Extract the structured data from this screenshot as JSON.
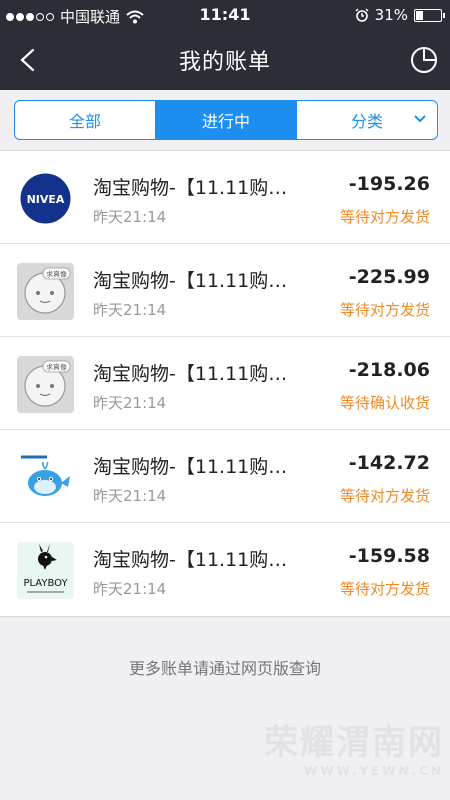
{
  "status_bar": {
    "carrier": "中国联通",
    "time": "11:41",
    "battery_pct": "31%",
    "battery_level": 0.31,
    "signal_strength": 3
  },
  "header": {
    "title": "我的账单",
    "back_icon": "chevron-left-icon",
    "chart_icon": "pie-chart-icon"
  },
  "tabs": [
    {
      "label": "全部",
      "active": false
    },
    {
      "label": "进行中",
      "active": true
    },
    {
      "label": "分类",
      "active": false
    }
  ],
  "bills": [
    {
      "title": "淘宝购物-【11.11购…",
      "time": "昨天21:14",
      "amount": "-195.26",
      "status": "等待对方发货",
      "icon": "nivea-logo"
    },
    {
      "title": "淘宝购物-【11.11购…",
      "time": "昨天21:14",
      "amount": "-225.99",
      "status": "等待对方发货",
      "icon": "placeholder-avatar",
      "badge": "求真像"
    },
    {
      "title": "淘宝购物-【11.11购…",
      "time": "昨天21:14",
      "amount": "-218.06",
      "status": "等待确认收货",
      "icon": "placeholder-avatar",
      "badge": "求真像"
    },
    {
      "title": "淘宝购物-【11.11购…",
      "time": "昨天21:14",
      "amount": "-142.72",
      "status": "等待对方发货",
      "icon": "whale-logo"
    },
    {
      "title": "淘宝购物-【11.11购…",
      "time": "昨天21:14",
      "amount": "-159.58",
      "status": "等待对方发货",
      "icon": "playboy-logo",
      "logo_text": "PLAYBOY"
    }
  ],
  "footer_note": "更多账单请通过网页版查询",
  "watermark": {
    "main": "荣耀渭南网",
    "sub": "WWW.YEWN.CN"
  },
  "colors": {
    "header_bg": "#2b2e36",
    "accent": "#1e8ff0",
    "status_orange": "#f08a24"
  }
}
